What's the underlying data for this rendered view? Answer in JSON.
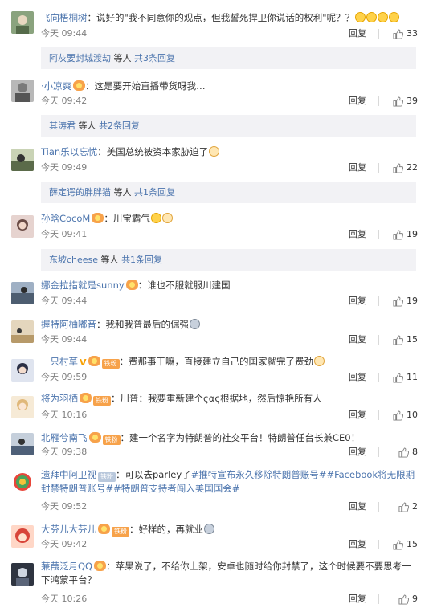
{
  "comments": [
    {
      "user": "飞向梧桐树",
      "text": "：说好的\"我不同意你的观点，但我誓死捍卫你说话的权利\"呢？？",
      "time": "今天 09:44",
      "reply": "回复",
      "likes": "33",
      "emoji": [
        "doge-emoji",
        "doge-emoji",
        "doge-emoji",
        "doge-emoji"
      ],
      "avatar_color": "#8aa37e",
      "sub": {
        "who": "阿灰要封城渡劫",
        "mid": " 等人 ",
        "more": "共3条回复"
      }
    },
    {
      "user": "·小凉爽",
      "text": "：这是要开始直播带货呀我…",
      "time": "今天 09:42",
      "reply": "回复",
      "likes": "39",
      "avatar_color": "#9a9a9a",
      "sub": {
        "who": "其涛君",
        "mid": " 等人 ",
        "more": "共2条回复"
      }
    },
    {
      "user": "Tian乐以忘忧",
      "text": "：美国总统被资本家胁迫了",
      "time": "今天 09:49",
      "reply": "回复",
      "likes": "22",
      "avatar_color": "#5b6b4a",
      "sub": {
        "who": "薛定谔的胖胖猫",
        "mid": " 等人 ",
        "more": "共1条回复"
      }
    },
    {
      "user": "孙晗CocoM",
      "text": "：川宝霸气",
      "time": "今天 09:41",
      "reply": "回复",
      "likes": "19",
      "avatar_color": "#c9a6a0",
      "sub": {
        "who": "东坡cheese",
        "mid": " 等人 ",
        "more": "共1条回复"
      }
    },
    {
      "user": "娜金拉措就是sunny",
      "text": "：谁也不服就服川建国",
      "time": "今天 09:44",
      "reply": "回复",
      "likes": "19",
      "avatar_color": "#6f7f95"
    },
    {
      "user": "握特阿柚嘟音",
      "text": "：我和我普最后的倔强",
      "time": "今天 09:44",
      "reply": "回复",
      "likes": "15",
      "avatar_color": "#cdb38a"
    },
    {
      "user": "一只村草",
      "fans": "铁粉",
      "text": "：费那事干嘛，直接建立自己的国家就完了费劲",
      "time": "今天 09:59",
      "reply": "回复",
      "likes": "11",
      "avatar_color": "#3b4a6b"
    },
    {
      "user": "将为羽栖",
      "fans": "铁粉",
      "text": "：川普：我要重新建个ςας根据地，然后惊艳所有人",
      "time": "今天 10:16",
      "reply": "回复",
      "likes": "10",
      "avatar_color": "#e8c9a8"
    },
    {
      "user": "北雁兮南飞",
      "fans": "铁粉",
      "text": "：建一个名字为特朗普的社交平台！特朗普任台长兼CE0！",
      "time": "今天 09:38",
      "reply": "回复",
      "likes": "8",
      "avatar_color": "#7a8ea8"
    },
    {
      "user": "遗拜中阿卫视",
      "fans": "铁粉",
      "text_prefix": "：可以去parley了",
      "topic1": "#推特宣布永久移除特朗普账号#",
      "topic2": "#Facebook将无限期封禁特朗普账号#",
      "topic3": "#特朗普支持者闯入美国国会#",
      "time": "今天 09:52",
      "reply": "回复",
      "likes": "2",
      "avatar_color": "#4aa35a"
    },
    {
      "user": "大芬儿大芬儿",
      "fans": "铁粉",
      "text": "：好样的，再就业",
      "time": "今天 09:42",
      "reply": "回复",
      "likes": "15",
      "avatar_color": "#d8453a"
    },
    {
      "user": "蒹葭泛月QQ",
      "text": "：苹果说了，不给你上架，安卓也随时给你封禁了，这个时候要不要思考一下鸿蒙平台？",
      "time": "今天 10:26",
      "reply": "回复",
      "likes": "9",
      "avatar_color": "#2e3440"
    }
  ],
  "colors": {
    "username": "#eb7350",
    "link": "#4b74ad",
    "meta": "#808080",
    "sub_bg": "#f2f2f5"
  },
  "icons": {
    "like": "thumbs-up-icon",
    "member": "vip-crown-icon"
  }
}
